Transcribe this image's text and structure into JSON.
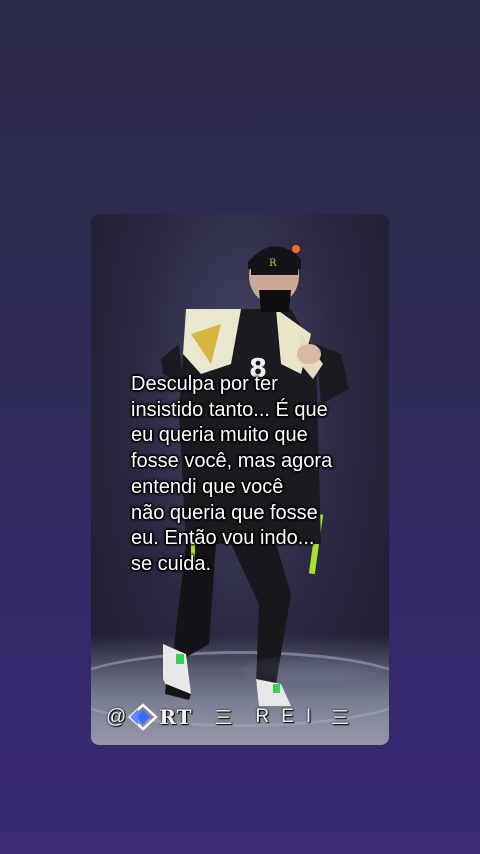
{
  "video": {
    "caption": "Desculpa por ter\ninsistido tanto... É que\neu queria muito que\nfosse você, mas agora\nentendi que você\nnão queria que fosse\neu. Então vou indo...\nse cuida.",
    "watermark": {
      "at": "@",
      "brand": "RT",
      "separator_left": "三",
      "name": "REI",
      "separator_right": "三"
    }
  },
  "colors": {
    "background_top": "#2b2948",
    "background_bottom": "#3a2a78",
    "caption_text": "#ffffff",
    "accent_green": "#a6e22e"
  },
  "icons": {
    "watermark_logo": "diamond-logo-icon"
  }
}
